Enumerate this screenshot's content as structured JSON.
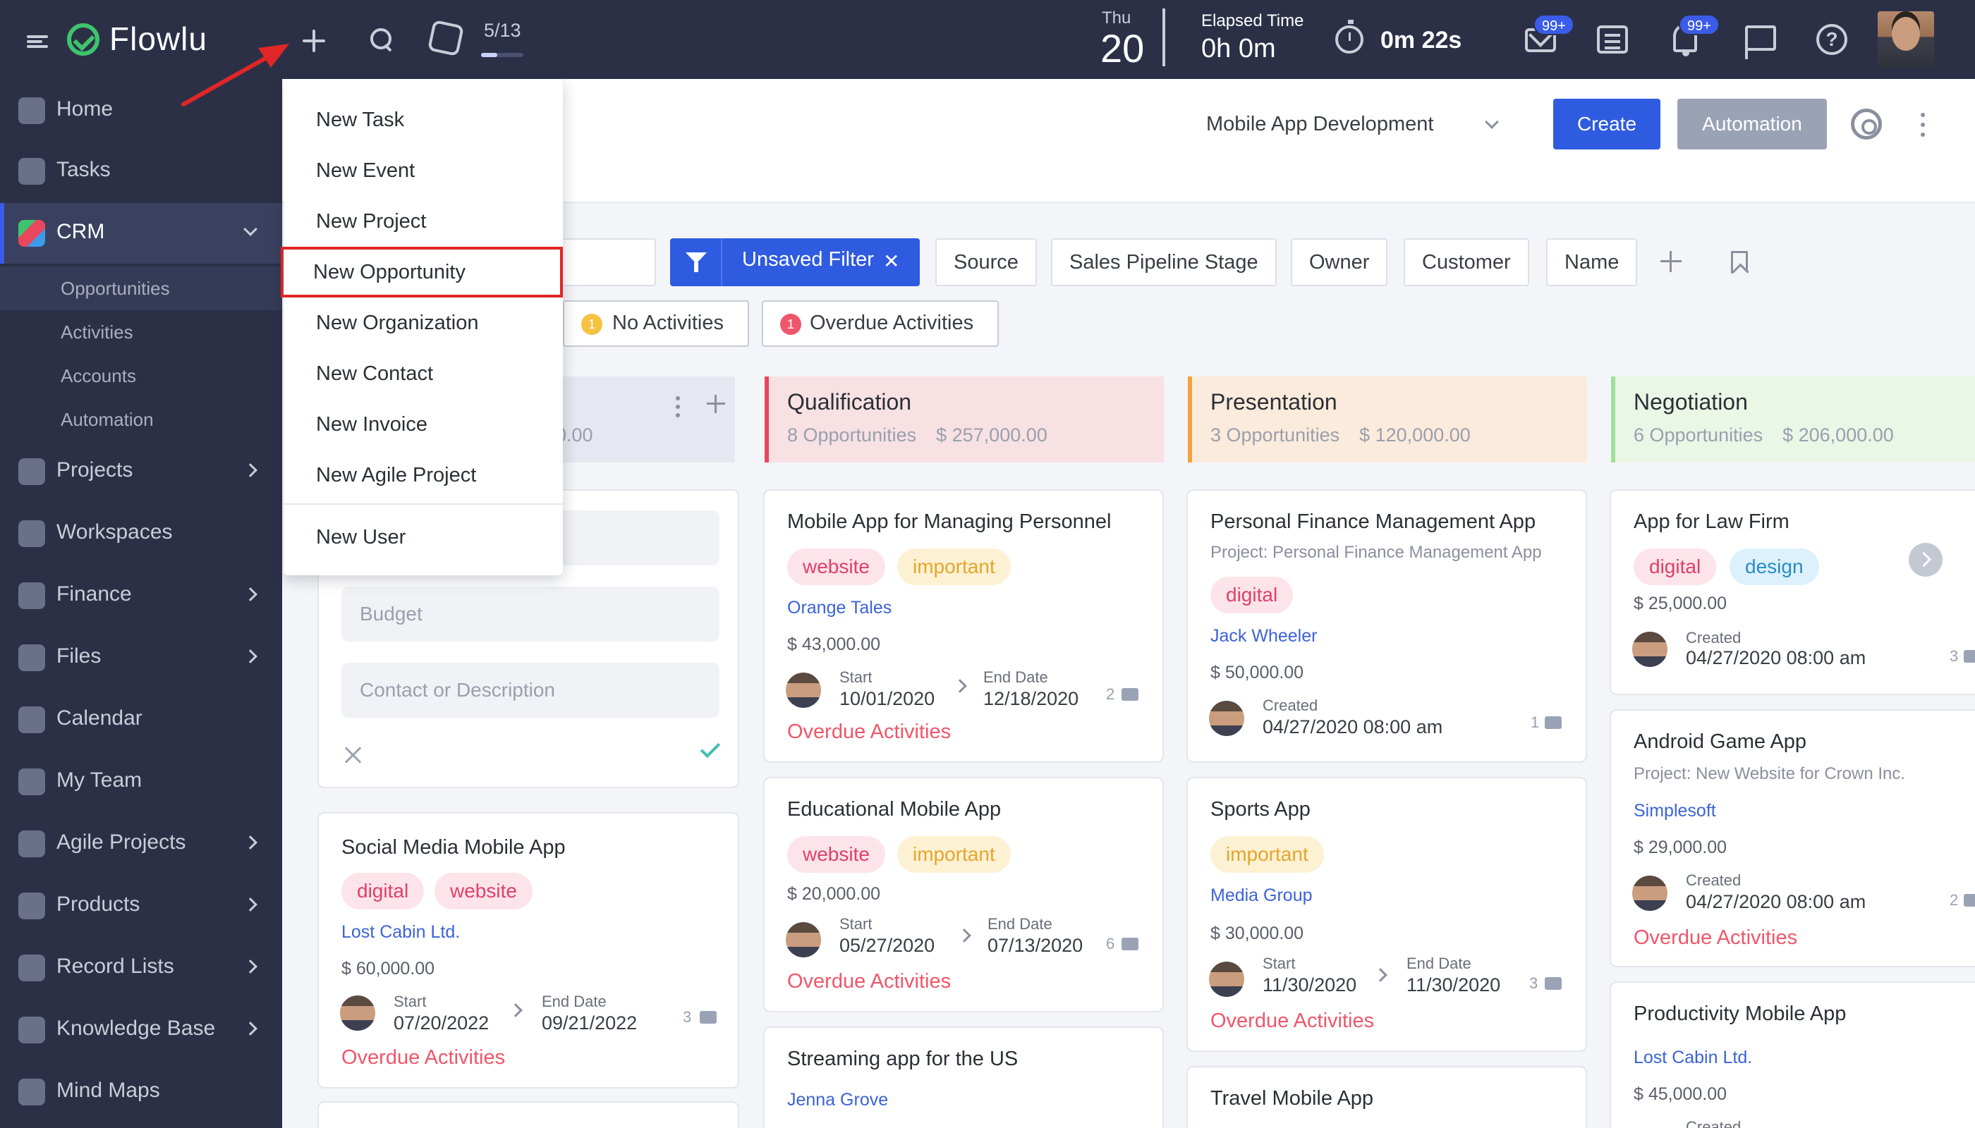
{
  "app": {
    "name": "Flowlu"
  },
  "topbar": {
    "task_counter": "5/13",
    "task_progress": 0.38,
    "day_name": "Thu",
    "day_number": "20",
    "elapsed_label": "Elapsed Time",
    "elapsed_value": "0h 0m",
    "timer_value": "0m 22s",
    "mail_badge": "99+",
    "notification_badge": "99+"
  },
  "sidebar": {
    "items": [
      {
        "label": "Home",
        "icon": "home-icon"
      },
      {
        "label": "Tasks",
        "icon": "tasks-icon"
      },
      {
        "label": "CRM",
        "icon": "crm-icon",
        "active": true
      },
      {
        "label": "Projects",
        "icon": "projects-icon"
      },
      {
        "label": "Workspaces",
        "icon": "workspaces-icon"
      },
      {
        "label": "Finance",
        "icon": "finance-icon"
      },
      {
        "label": "Files",
        "icon": "files-icon"
      },
      {
        "label": "Calendar",
        "icon": "calendar-icon"
      },
      {
        "label": "My Team",
        "icon": "team-icon"
      },
      {
        "label": "Agile Projects",
        "icon": "agile-icon"
      },
      {
        "label": "Products",
        "icon": "products-icon"
      },
      {
        "label": "Record Lists",
        "icon": "record-lists-icon"
      },
      {
        "label": "Knowledge Base",
        "icon": "knowledge-base-icon"
      },
      {
        "label": "Mind Maps",
        "icon": "mind-maps-icon"
      }
    ],
    "crm_sub": [
      "Opportunities",
      "Activities",
      "Accounts",
      "Automation"
    ]
  },
  "header": {
    "project_select": "Mobile App Development",
    "create_label": "Create",
    "automation_label": "Automation"
  },
  "filters": {
    "active_filter": "Unsaved Filter",
    "chips": [
      "Source",
      "Sales Pipeline Stage",
      "Owner",
      "Customer",
      "Name"
    ],
    "no_activities": {
      "count": "1",
      "label": "No Activities"
    },
    "overdue_activities": {
      "count": "1",
      "label": "Overdue Activities"
    }
  },
  "dropdown": {
    "items": [
      "New Task",
      "New Event",
      "New Project",
      "New Opportunity",
      "New Organization",
      "New Contact",
      "New Invoice",
      "New Agile Project",
      "New User"
    ],
    "highlighted": "New Opportunity"
  },
  "first_column": {
    "amount_partial": "0.00",
    "form": {
      "budget_placeholder": "Budget",
      "contact_placeholder": "Contact or Description"
    }
  },
  "columns": [
    {
      "title": "Qualification",
      "count": "8 Opportunities",
      "amount": "$ 257,000.00",
      "accent": "#e8475d",
      "bg": "#f7e1e3"
    },
    {
      "title": "Presentation",
      "count": "3 Opportunities",
      "amount": "$ 120,000.00",
      "accent": "#f2a43a",
      "bg": "#fbebdc"
    },
    {
      "title": "Negotiation",
      "count": "6 Opportunities",
      "amount": "$ 206,000.00",
      "accent": "#9fe09a",
      "bg": "#eaf6e6"
    }
  ],
  "cards": {
    "c1": {
      "title": "Social Media Mobile App",
      "tags": [
        "digital",
        "website"
      ],
      "customer": "Lost Cabin Ltd.",
      "amount": "$ 60,000.00",
      "start_label": "Start",
      "start": "07/20/2022",
      "end_label": "End Date",
      "end": "09/21/2022",
      "comments": "3",
      "overdue": "Overdue Activities"
    },
    "q1": {
      "title": "Mobile App for Managing Personnel",
      "tags": [
        "website",
        "important"
      ],
      "customer": "Orange Tales",
      "amount": "$ 43,000.00",
      "start_label": "Start",
      "start": "10/01/2020",
      "end_label": "End Date",
      "end": "12/18/2020",
      "comments": "2",
      "overdue": "Overdue Activities"
    },
    "q2": {
      "title": "Educational Mobile App",
      "tags": [
        "website",
        "important"
      ],
      "amount": "$ 20,000.00",
      "start_label": "Start",
      "start": "05/27/2020",
      "end_label": "End Date",
      "end": "07/13/2020",
      "comments": "6",
      "overdue": "Overdue Activities"
    },
    "q3": {
      "title": "Streaming app for the US",
      "customer": "Jenna Grove"
    },
    "p1": {
      "title": "Personal Finance Management App",
      "project": "Project: Personal Finance Management App",
      "tags": [
        "digital"
      ],
      "customer": "Jack Wheeler",
      "amount": "$ 50,000.00",
      "created_label": "Created",
      "created": "04/27/2020 08:00 am",
      "comments": "1"
    },
    "p2": {
      "title": "Sports App",
      "tags": [
        "important"
      ],
      "customer": "Media Group",
      "amount": "$ 30,000.00",
      "start_label": "Start",
      "start": "11/30/2020",
      "end_label": "End Date",
      "end": "11/30/2020",
      "comments": "3",
      "overdue": "Overdue Activities"
    },
    "p3": {
      "title": "Travel Mobile App"
    },
    "n1": {
      "title": "App for Law Firm",
      "tags": [
        "digital",
        "design"
      ],
      "amount": "$ 25,000.00",
      "created_label": "Created",
      "created": "04/27/2020 08:00 am",
      "comments": "3"
    },
    "n2": {
      "title": "Android Game App",
      "project": "Project: New Website for Crown Inc.",
      "customer": "Simplesoft",
      "amount": "$ 29,000.00",
      "created_label": "Created",
      "created": "04/27/2020 08:00 am",
      "comments": "2",
      "overdue": "Overdue Activities"
    },
    "n3": {
      "title": "Productivity Mobile App",
      "customer": "Lost Cabin Ltd.",
      "amount": "$ 45,000.00",
      "created_label": "Created"
    }
  }
}
